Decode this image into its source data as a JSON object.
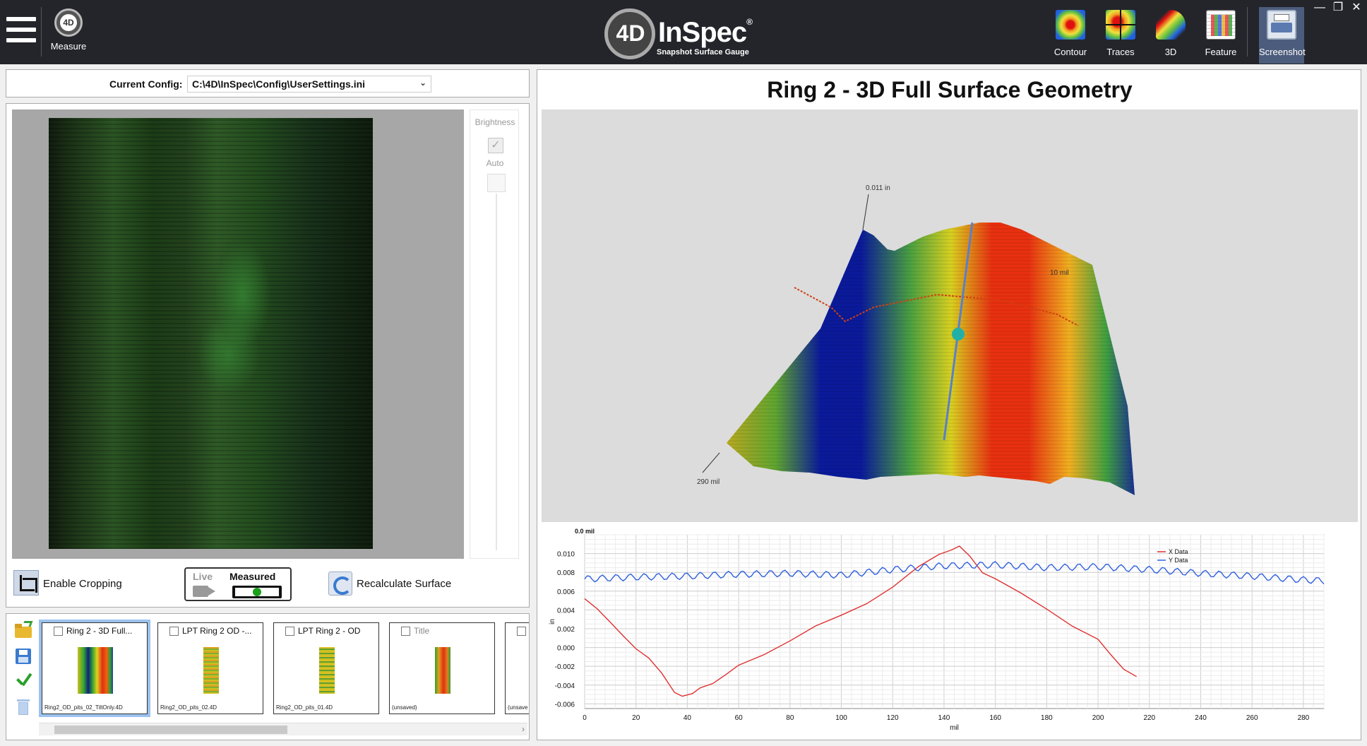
{
  "topbar": {
    "measure_label": "Measure",
    "logo_mark": "4D",
    "logo_name": "InSpec",
    "logo_reg": "®",
    "logo_tagline": "Snapshot Surface Gauge",
    "tools": [
      {
        "label": "Contour",
        "icon": "contour-icon"
      },
      {
        "label": "Traces",
        "icon": "traces-icon"
      },
      {
        "label": "3D",
        "icon": "3d-icon"
      },
      {
        "label": "Feature",
        "icon": "feature-icon"
      },
      {
        "label": "Screenshot",
        "icon": "screenshot-icon",
        "active": true
      }
    ],
    "window": {
      "minimize": "—",
      "restore": "❐",
      "close": "✕"
    }
  },
  "config": {
    "label": "Current Config:",
    "value": "C:\\4D\\InSpec\\Config\\UserSettings.ini"
  },
  "camera": {
    "brightness_label": "Brightness",
    "auto_label": "Auto",
    "auto_checked": true,
    "enable_cropping_label": "Enable Cropping",
    "live_label": "Live",
    "measured_label": "Measured",
    "recalculate_label": "Recalculate Surface"
  },
  "files": {
    "items": [
      {
        "title": "Ring 2 - 3D Full...",
        "filename": "Ring2_OD_pits_02_TiltOnly.4D",
        "selected": true,
        "preview": "wide"
      },
      {
        "title": "LPT Ring 2 OD -...",
        "filename": "Ring2_OD_pits_02.4D",
        "selected": false,
        "preview": "narrow"
      },
      {
        "title": "LPT Ring 2 - OD",
        "filename": "Ring2_OD_pits_01.4D",
        "selected": false,
        "preview": "narrow"
      },
      {
        "title": "Title",
        "filename": "(unsaved)",
        "selected": false,
        "preview": "orange",
        "placeholder": true
      },
      {
        "title": "",
        "filename": "(unsave",
        "selected": false,
        "preview": "none"
      }
    ]
  },
  "surface": {
    "title": "Ring 2 - 3D Full Surface Geometry",
    "z_label": "0.011 in",
    "x_label": "290 mil",
    "y_label": "10 mil"
  },
  "chart_data": {
    "type": "line",
    "title": "",
    "xlabel": "mil",
    "ylabel": "in",
    "xlim": [
      0,
      288
    ],
    "ylim": [
      -0.0065,
      0.012
    ],
    "x_ticks": [
      0,
      20,
      40,
      60,
      80,
      100,
      120,
      140,
      160,
      180,
      200,
      220,
      240,
      260,
      280
    ],
    "y_ticks": [
      0.01,
      0.008,
      0.006,
      0.004,
      0.002,
      0.0,
      -0.002,
      -0.004,
      -0.006
    ],
    "y_tick_labels": [
      "0.010",
      "0.008",
      "0.006",
      "0.004",
      "0.002",
      "0.000",
      "-0.002",
      "-0.004",
      "-0.006"
    ],
    "top_label": "0.0 mil",
    "grid": true,
    "legend": "top-right",
    "series": [
      {
        "name": "X Data",
        "color": "#e03030",
        "x": [
          0,
          5,
          10,
          15,
          20,
          25,
          30,
          35,
          38,
          42,
          45,
          50,
          55,
          60,
          70,
          80,
          90,
          100,
          110,
          120,
          130,
          138,
          143,
          146,
          150,
          155,
          160,
          170,
          180,
          190,
          200,
          205,
          210,
          215
        ],
        "y": [
          0.0052,
          0.004,
          0.0028,
          0.0012,
          -0.0002,
          -0.001,
          -0.0028,
          -0.0048,
          -0.0053,
          -0.005,
          -0.0044,
          -0.0038,
          -0.0028,
          -0.002,
          -0.0007,
          0.0008,
          0.0022,
          0.0034,
          0.0048,
          0.0064,
          0.0085,
          0.0098,
          0.0105,
          0.0108,
          0.0098,
          0.008,
          0.0072,
          0.0058,
          0.0042,
          0.0022,
          0.0008,
          -0.0008,
          -0.0022,
          -0.0032
        ]
      },
      {
        "name": "Y Data",
        "color": "#3060e0",
        "x": [
          0,
          20,
          40,
          60,
          80,
          100,
          120,
          140,
          160,
          180,
          200,
          220,
          240,
          260,
          280,
          288
        ],
        "y": [
          0.0073,
          0.0075,
          0.0076,
          0.0078,
          0.0079,
          0.0077,
          0.0083,
          0.0087,
          0.0088,
          0.0085,
          0.0086,
          0.0083,
          0.0079,
          0.0076,
          0.0072,
          0.0071
        ]
      }
    ]
  }
}
